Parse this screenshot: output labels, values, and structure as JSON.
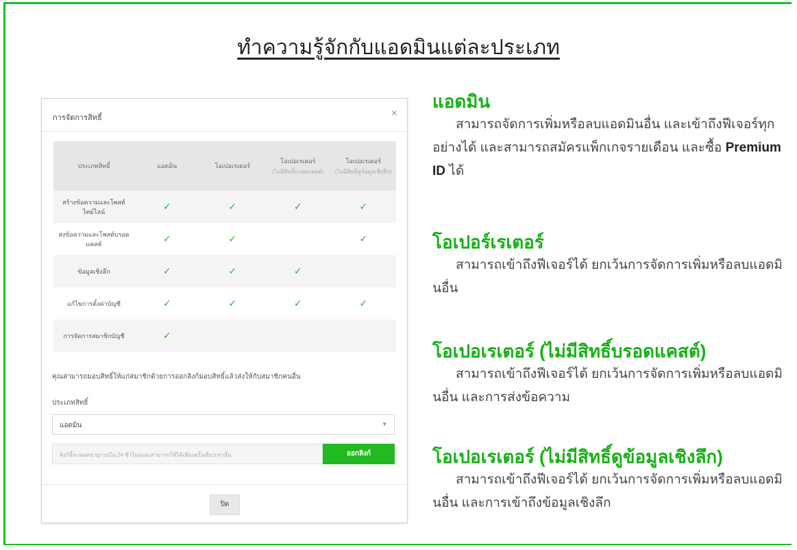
{
  "main_title": "ทำความรู้จักกับแอดมินแต่ละประเภท",
  "modal": {
    "title": "การจัดการสิทธิ์",
    "close_glyph": "×",
    "table": {
      "headers": [
        {
          "label": "ประเภทสิทธิ์",
          "sub": ""
        },
        {
          "label": "แอดมิน",
          "sub": ""
        },
        {
          "label": "โอเปอเรเตอร์",
          "sub": ""
        },
        {
          "label": "โอเปอเรเตอร์",
          "sub": "(ไม่มีสิทธิ์บรอดแคสต์)"
        },
        {
          "label": "โอเปอเรเตอร์",
          "sub": "(ไม่มีสิทธิ์ดูข้อมูลเชิงลึก)"
        }
      ],
      "rows": [
        {
          "label": "สร้างข้อความและโพสต์ไทม์ไลน์",
          "checks": [
            true,
            true,
            true,
            true
          ]
        },
        {
          "label": "ส่งข้อความและโพสต์บรอดแคสต์",
          "checks": [
            true,
            true,
            false,
            true
          ]
        },
        {
          "label": "ข้อมูลเชิงลึก",
          "checks": [
            true,
            true,
            true,
            false
          ]
        },
        {
          "label": "แก้ไขการตั้งค่าบัญชี",
          "checks": [
            true,
            true,
            true,
            true
          ]
        },
        {
          "label": "การจัดการสมาชิกบัญชี",
          "checks": [
            true,
            false,
            false,
            false
          ]
        }
      ],
      "check_glyph": "✓"
    },
    "description": "คุณสามารถมอบสิทธิ์ให้แก่สมาชิกด้วยการออกลิงก์มอบสิทธิ์แล้วส่งให้กับสมาชิกคนอื่น",
    "type_label": "ประเภทสิทธิ์",
    "select_value": "แอดมิน",
    "invite_placeholder": "ลิงก์นี้จะหมดอายุภายใน 24 ชั่วโมงและสามารถใช้ได้เพียงครั้งเดียวเท่านั้น",
    "invite_button": "ออกลิงก์",
    "close_button": "ปิด"
  },
  "roles": [
    {
      "title": "แอดมิน",
      "body": "สามารถจัดการเพิ่มหรือลบแอดมินอื่น และเข้าถึงฟีเจอร์ทุกอย่างได้ และสามารถสมัครแพ็กเกจรายเดือน และซื้อ",
      "bold": "Premium ID",
      "tail": " ได้"
    },
    {
      "title": "โอเปอร์เรเตอร์",
      "body": "สามารถเข้าถึงฟีเจอร์ได้ ยกเว้นการจัดการเพิ่มหรือลบแอดมินอื่น",
      "bold": "",
      "tail": ""
    },
    {
      "title": "โอเปอเรเตอร์ (ไม่มีสิทธิ์บรอดแคสต์)",
      "body": "สามารถเข้าถึงฟีเจอร์ได้ ยกเว้นการจัดการเพิ่มหรือลบแอดมินอื่น และการส่งข้อความ",
      "bold": "",
      "tail": ""
    },
    {
      "title": "โอเปอเรเตอร์ (ไม่มีสิทธิ์ดูข้อมูลเชิงลึก)",
      "body": "สามารถเข้าถึงฟีเจอร์ได้ ยกเว้นการจัดการเพิ่มหรือลบแอดมินอื่น และการเข้าถึงข้อมูลเชิงลึก",
      "bold": "",
      "tail": ""
    }
  ],
  "colors": {
    "accent": "#22b922",
    "role_title": "#17b017"
  }
}
